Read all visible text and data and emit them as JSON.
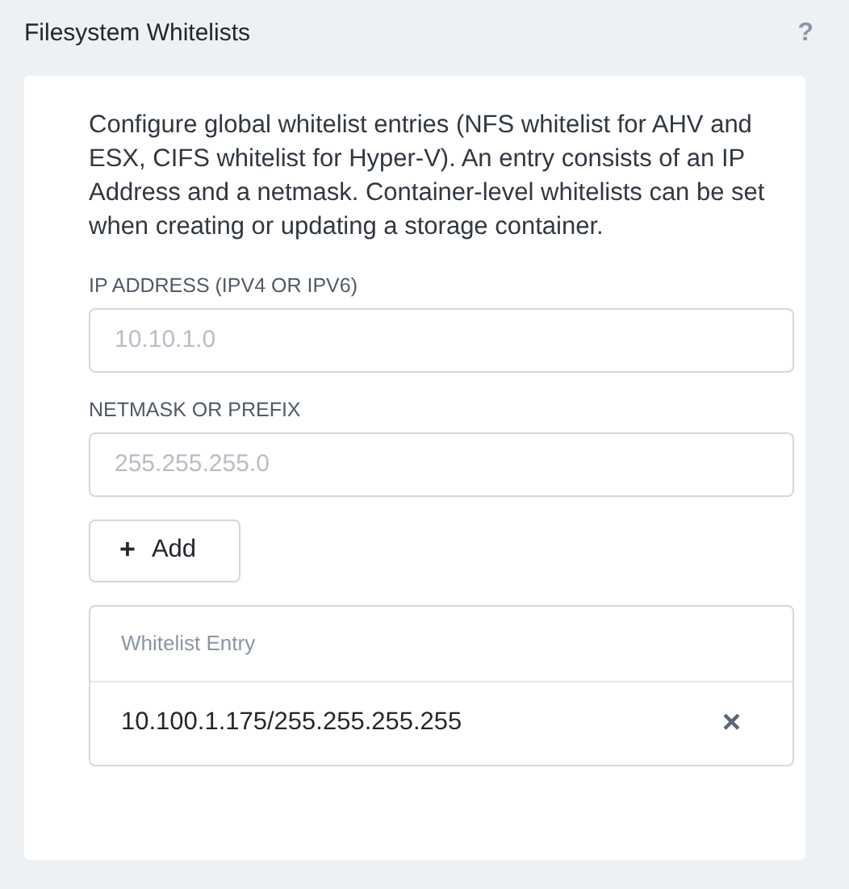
{
  "panel": {
    "title": "Filesystem Whitelists",
    "help": "?"
  },
  "description": "Configure global whitelist entries (NFS whitelist for AHV and ESX, CIFS whitelist for Hyper-V). An entry consists of an IP Address and a netmask. Container-level whitelists can be set when creating or updating a storage container.",
  "fields": [
    {
      "label": "IP ADDRESS (IPV4 OR IPV6)",
      "placeholder": "10.10.1.0"
    },
    {
      "label": "NETMASK OR PREFIX",
      "placeholder": "255.255.255.0"
    }
  ],
  "add_button": {
    "icon": "+",
    "label": "Add"
  },
  "table": {
    "columns": [
      "Whitelist Entry"
    ],
    "rows": [
      {
        "entry": "10.100.1.175/255.255.255.255",
        "remove": "×"
      }
    ]
  }
}
